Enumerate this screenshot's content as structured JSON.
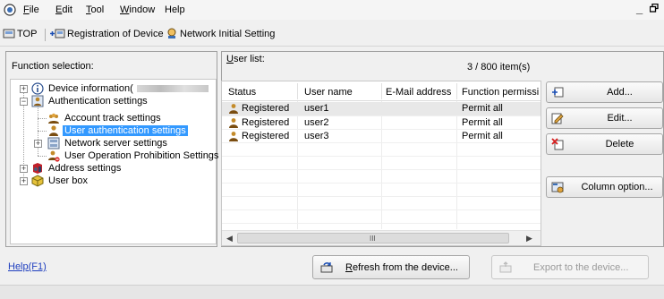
{
  "menu": {
    "items": [
      {
        "text": "File",
        "u": "F"
      },
      {
        "text": "Edit",
        "u": "E"
      },
      {
        "text": "Tool",
        "u": "T"
      },
      {
        "text": "Window",
        "u": "W"
      },
      {
        "text": "Help",
        "u": ""
      }
    ],
    "minimize": "_",
    "restore": "❐"
  },
  "toolbar": {
    "top_label": "TOP",
    "registration_label": "Registration of Device",
    "network_label": "Network Initial Setting"
  },
  "function_panel": {
    "label": "Function selection:",
    "tree": [
      {
        "label": "Device information(",
        "icon": "info-icon",
        "expandable": true,
        "state": "collapsed"
      },
      {
        "label": "Authentication settings",
        "icon": "authentication-icon",
        "expandable": true,
        "state": "expanded"
      },
      {
        "label": "Account track settings",
        "icon": "account-group-icon"
      },
      {
        "label": "User authentication settings",
        "icon": "user-icon",
        "selected": true
      },
      {
        "label": "Network server settings",
        "icon": "network-server-icon",
        "expandable": true,
        "state": "collapsed"
      },
      {
        "label": "User Operation Prohibition Settings",
        "icon": "user-prohibit-icon"
      },
      {
        "label": "Address settings",
        "icon": "address-book-icon",
        "expandable": true,
        "state": "collapsed"
      },
      {
        "label": "User box",
        "icon": "user-box-icon",
        "expandable": true,
        "state": "collapsed"
      }
    ]
  },
  "user_list": {
    "label": "User list:",
    "count": "3 / 800 item(s)",
    "columns": [
      "Status",
      "User name",
      "E-Mail address",
      "Function permission"
    ],
    "rows": [
      {
        "status": "Registered",
        "user_name": "user1",
        "email": "",
        "permission": "Permit all"
      },
      {
        "status": "Registered",
        "user_name": "user2",
        "email": "",
        "permission": "Permit all"
      },
      {
        "status": "Registered",
        "user_name": "user3",
        "email": "",
        "permission": "Permit all"
      }
    ],
    "scroll_grip": "III"
  },
  "actions": {
    "add": "Add...",
    "edit": "Edit...",
    "delete": "Delete",
    "column_option": "Column option..."
  },
  "footer": {
    "help": "Help(F1)",
    "refresh": "Refresh from the device...",
    "export": "Export to the device..."
  },
  "colors": {
    "selection": "#3399ff",
    "link": "#1f3fbf",
    "row_highlight": "#e8e8e8"
  }
}
